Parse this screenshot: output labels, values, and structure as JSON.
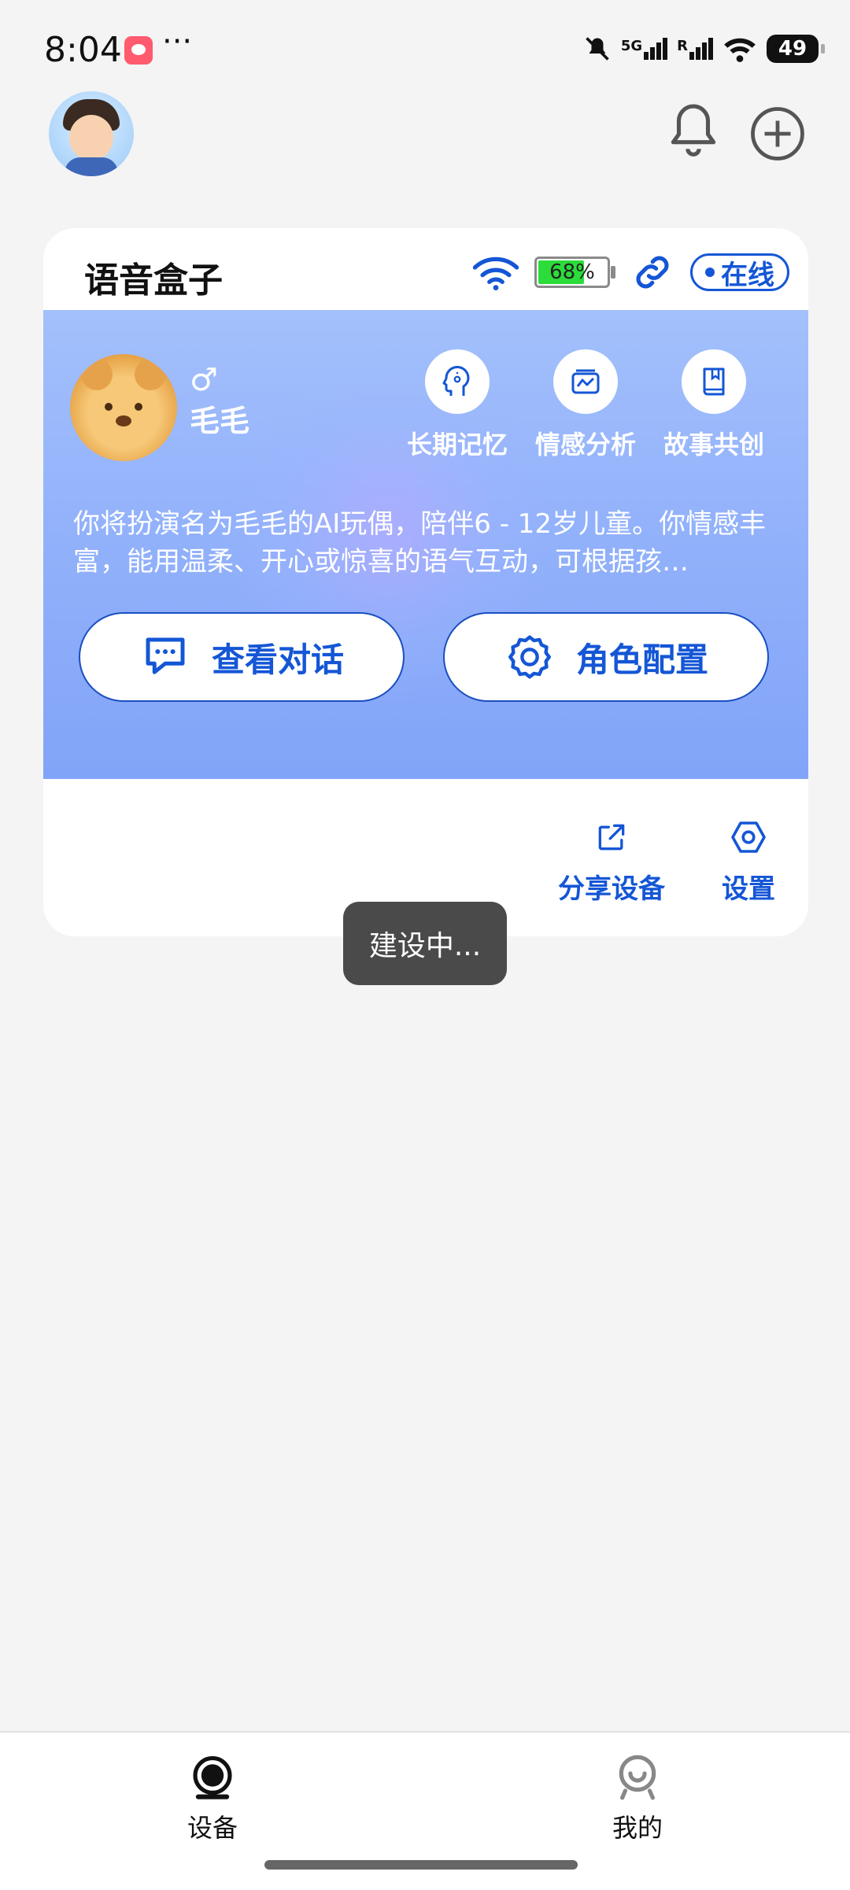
{
  "status_bar": {
    "time": "8:04",
    "more": "···",
    "network": "5G",
    "roaming": "R",
    "battery": "49"
  },
  "header": {
    "avatar_icon": "user-avatar",
    "bell_icon": "bell-icon",
    "add_icon": "plus-circle-icon"
  },
  "device_card": {
    "title": "语音盒子",
    "battery_percent": "68%",
    "battery_level": 0.68,
    "status": "在线",
    "pet": {
      "gender_symbol": "♂",
      "name": "毛毛"
    },
    "features": [
      {
        "label": "长期记忆",
        "icon": "brain-icon"
      },
      {
        "label": "情感分析",
        "icon": "chart-icon"
      },
      {
        "label": "故事共创",
        "icon": "book-icon"
      }
    ],
    "description": "你将扮演名为毛毛的AI玩偶，陪伴6 - 12岁儿童。你情感丰富，能用温柔、开心或惊喜的语气互动，可根据孩…",
    "buttons": {
      "view_conversation": "查看对话",
      "role_config": "角色配置"
    },
    "actions": {
      "share": "分享设备",
      "settings": "设置"
    }
  },
  "toast": "建设中...",
  "bottom_nav": {
    "devices": "设备",
    "mine": "我的"
  },
  "colors": {
    "accent": "#1456d6",
    "panel_top": "#a3c0fb",
    "panel_bottom": "#82a4f8",
    "battery_fill": "#2bdc3a",
    "background": "#f4f4f4"
  }
}
